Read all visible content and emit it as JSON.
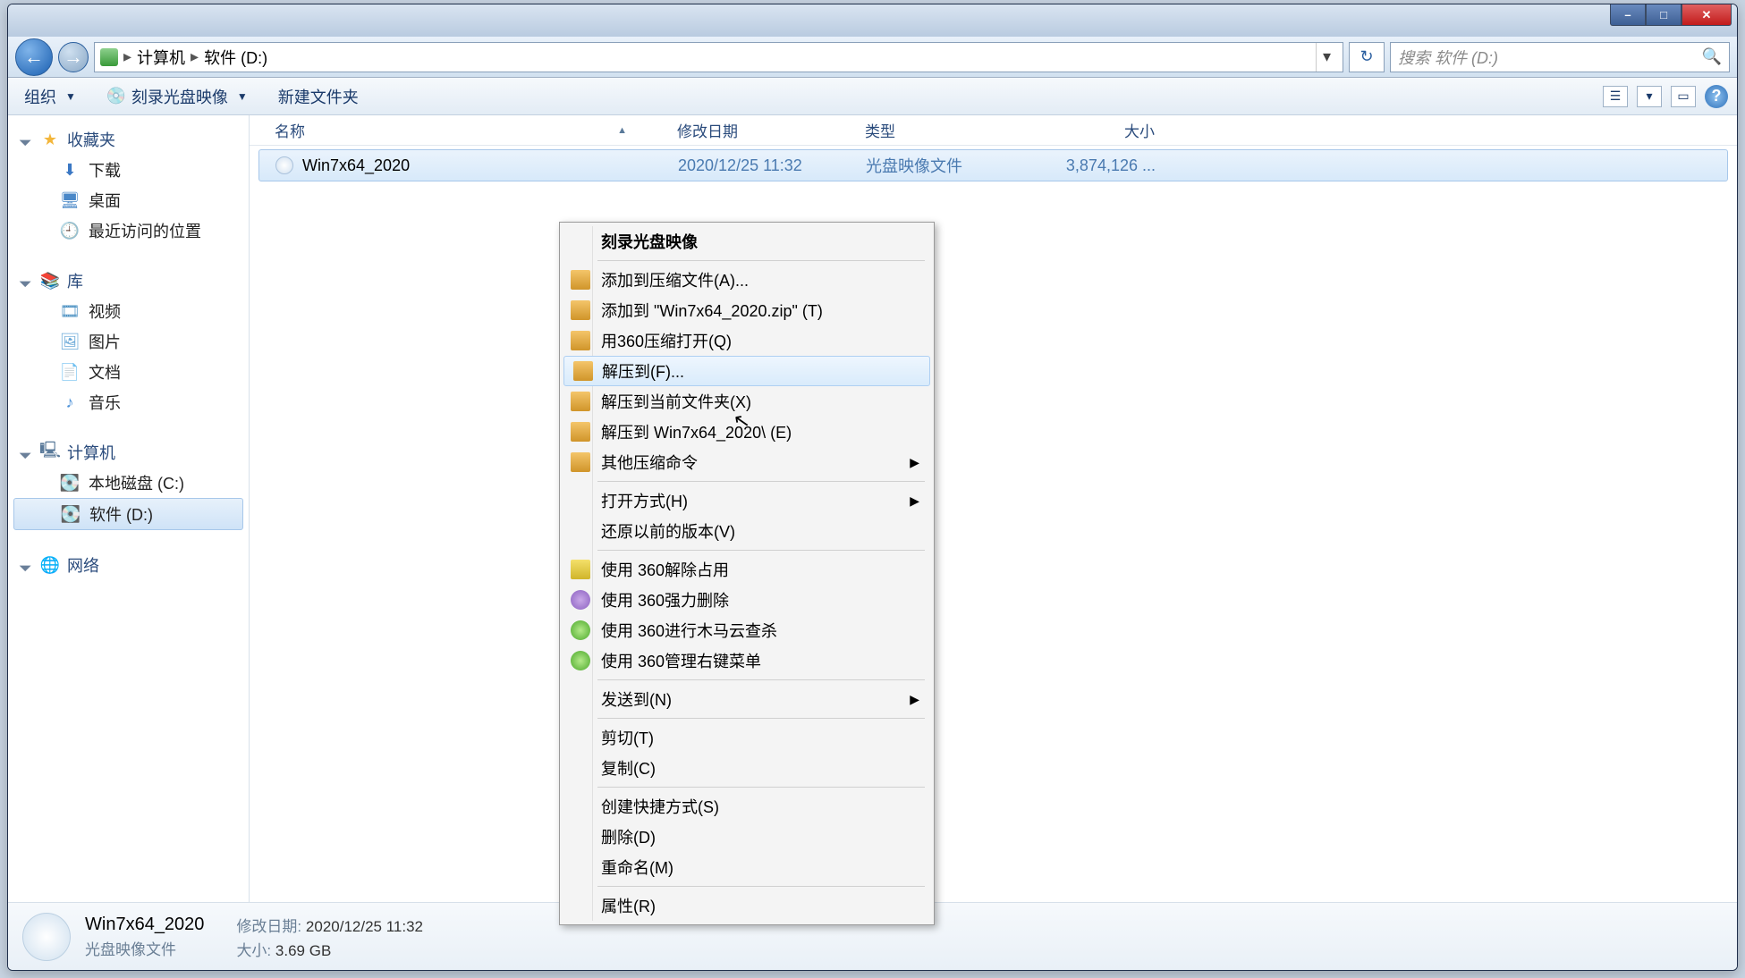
{
  "titlebar": {
    "min": "–",
    "max": "□",
    "close": "✕"
  },
  "nav": {
    "back": "←",
    "fwd": "→",
    "crumb1": "计算机",
    "sep": "▸",
    "crumb2": "软件 (D:)",
    "drop": "▾",
    "refresh": "↻",
    "search_placeholder": "搜索 软件 (D:)",
    "mag": "🔍"
  },
  "toolbar": {
    "organize": "组织",
    "organize_drop": "▼",
    "burn": "刻录光盘映像",
    "burn_drop": "▼",
    "newfolder": "新建文件夹",
    "view_drop": "▾",
    "help": "?"
  },
  "sidebar": {
    "fav": "收藏夹",
    "fav_items": {
      "dl": "下载",
      "desk": "桌面",
      "recent": "最近访问的位置"
    },
    "lib": "库",
    "lib_items": {
      "vid": "视频",
      "pic": "图片",
      "doc": "文档",
      "mus": "音乐"
    },
    "comp": "计算机",
    "comp_items": {
      "c": "本地磁盘 (C:)",
      "d": "软件 (D:)"
    },
    "net": "网络"
  },
  "columns": {
    "name": "名称",
    "date": "修改日期",
    "type": "类型",
    "size": "大小",
    "sort": "▲"
  },
  "file": {
    "name": "Win7x64_2020",
    "date": "2020/12/25 11:32",
    "type": "光盘映像文件",
    "size": "3,874,126 ..."
  },
  "context": {
    "burn": "刻录光盘映像",
    "add_archive": "添加到压缩文件(A)...",
    "add_zip": "添加到 \"Win7x64_2020.zip\" (T)",
    "open_360": "用360压缩打开(Q)",
    "extract_to": "解压到(F)...",
    "extract_here": "解压到当前文件夹(X)",
    "extract_named": "解压到 Win7x64_2020\\ (E)",
    "other_zip": "其他压缩命令",
    "open_with": "打开方式(H)",
    "restore_prev": "还原以前的版本(V)",
    "unlock_360": "使用 360解除占用",
    "force_del_360": "使用 360强力删除",
    "scan_360": "使用 360进行木马云查杀",
    "menu_360": "使用 360管理右键菜单",
    "send_to": "发送到(N)",
    "cut": "剪切(T)",
    "copy": "复制(C)",
    "shortcut": "创建快捷方式(S)",
    "delete": "删除(D)",
    "rename": "重命名(M)",
    "props": "属性(R)"
  },
  "details": {
    "title": "Win7x64_2020",
    "type": "光盘映像文件",
    "date_lbl": "修改日期:",
    "date": "2020/12/25 11:32",
    "size_lbl": "大小:",
    "size": "3.69 GB"
  }
}
